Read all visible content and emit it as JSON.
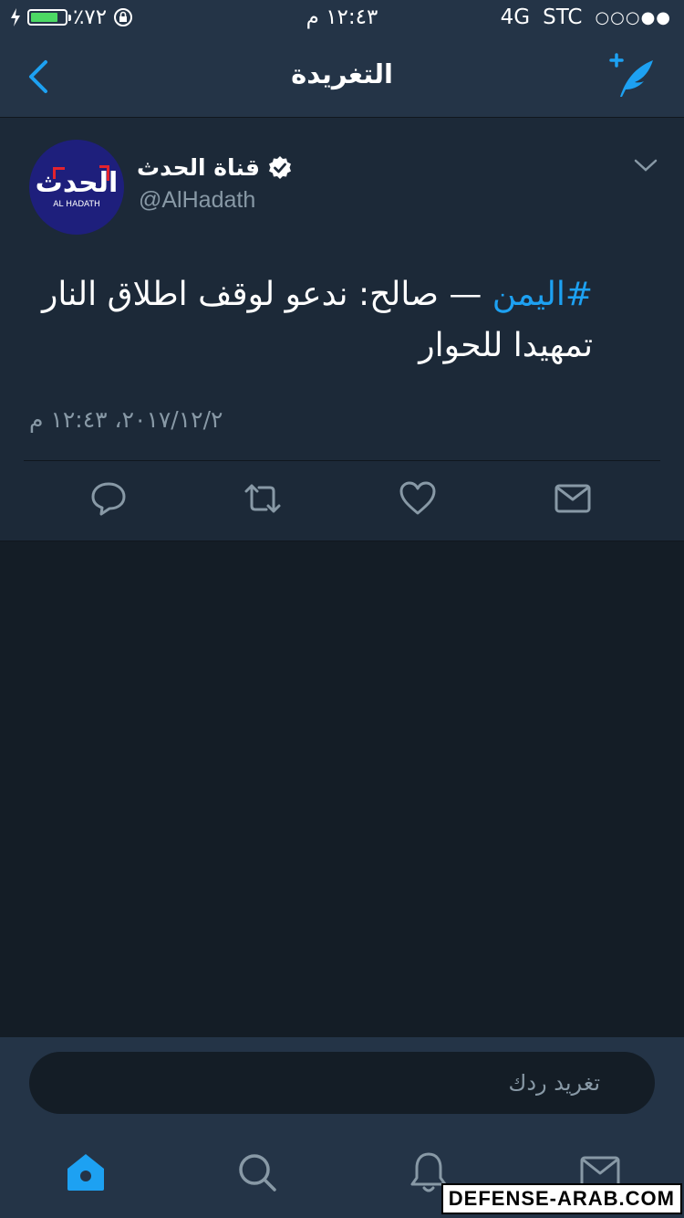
{
  "status_bar": {
    "battery_percent": "٪٧٢",
    "battery_level": 0.72,
    "time": "١٢:٤٣ م",
    "network": "4G",
    "carrier": "STC",
    "signal": "○○○●●"
  },
  "nav": {
    "title": "التغريدة"
  },
  "tweet": {
    "display_name": "قناة الحدث",
    "handle": "@AlHadath",
    "avatar_logo": "الحدث",
    "avatar_sub": "AL HADATH",
    "hashtag": "#اليمن",
    "text": " — صالح: ندعو لوقف اطلاق النار تمهيدا للحوار",
    "timestamp": "٢٠١٧/١٢/٢، ١٢:٤٣ م"
  },
  "reply": {
    "placeholder": "تغريد ردك"
  },
  "watermark": "DEFENSE-ARAB.COM",
  "colors": {
    "background": "#141d26",
    "bar": "#243447",
    "card": "#1c2938",
    "accent": "#1da1f2",
    "muted": "#8899a6"
  }
}
